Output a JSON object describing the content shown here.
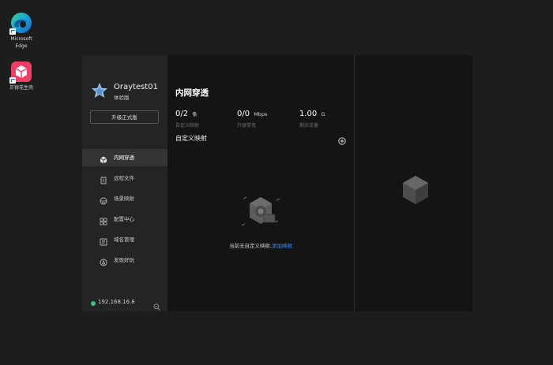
{
  "desktop": {
    "icons": [
      {
        "name": "Microsoft Edge",
        "line1": "Microsoft",
        "line2": "Edge"
      },
      {
        "name": "贝锐花生壳",
        "line1": "贝锐花生壳"
      }
    ]
  },
  "window": {
    "titlebar": {
      "buttons": [
        "layout-grid-icon",
        "menu-icon",
        "minimize-icon",
        "close-icon"
      ]
    },
    "user": {
      "name": "Oraytest01",
      "tier": "体验版",
      "upgrade_label": "升级正式版"
    },
    "nav": [
      {
        "label": "内网穿透",
        "icon": "tunnel-icon",
        "active": true
      },
      {
        "label": "远程文件",
        "icon": "remote-file-icon",
        "active": false
      },
      {
        "label": "场景映射",
        "icon": "scene-mapping-icon",
        "active": false
      },
      {
        "label": "配置中心",
        "icon": "config-center-icon",
        "active": false
      },
      {
        "label": "域名管理",
        "icon": "domain-manage-icon",
        "active": false
      },
      {
        "label": "发现好玩",
        "icon": "discover-icon",
        "active": false
      }
    ],
    "ip": "192.168.16.8",
    "main": {
      "title": "内网穿透",
      "stats": [
        {
          "value": "0/2",
          "unit": "条",
          "caption": "自定义映射"
        },
        {
          "value": "0/0",
          "unit": "Mbps",
          "caption": "升级带宽"
        },
        {
          "value": "1.00",
          "unit": "G",
          "caption": "剩余流量"
        }
      ],
      "section_title": "自定义映射",
      "empty_text": "当前无自定义映射,",
      "empty_link": "添加映射"
    }
  }
}
